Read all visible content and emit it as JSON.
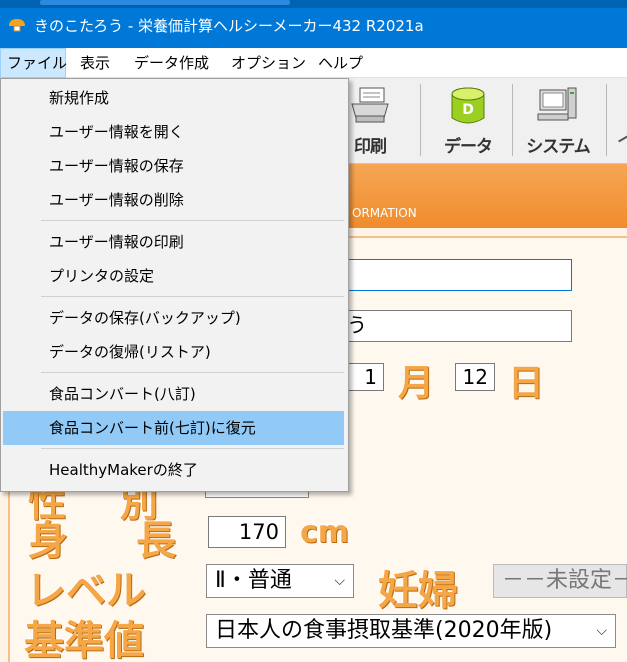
{
  "window": {
    "title": "きのこたろう - 栄養価計算ヘルシーメーカー432 R2021a"
  },
  "menubar": {
    "items": [
      "ファイル",
      "表示",
      "データ作成",
      "オプション",
      "ヘルプ"
    ]
  },
  "toolbar": {
    "buttons": [
      {
        "label": "印刷",
        "icon": "printer-icon"
      },
      {
        "label": "データ",
        "icon": "database-icon"
      },
      {
        "label": "システム",
        "icon": "computer-icon"
      }
    ]
  },
  "header": {
    "subtitle": "ORMATION"
  },
  "file_menu": {
    "items": [
      "新規作成",
      "ユーザー情報を開く",
      "ユーザー情報の保存",
      "ユーザー情報の削除",
      "ユーザー情報の印刷",
      "プリンタの設定",
      "データの保存(バックアップ)",
      "データの復帰(リストア)",
      "食品コンバート(八訂)",
      "食品コンバート前(七訂)に復元",
      "HealthyMakerの終了"
    ],
    "highlighted_index": 9
  },
  "form": {
    "field2_value": "う",
    "birth_month": "1",
    "birth_day": "12",
    "month_label": "月",
    "day_label": "日",
    "sex_label": "性　別",
    "height_label": "身　長",
    "height_value": "170",
    "height_unit": "cm",
    "level_label": "レベル",
    "level_value": "Ⅱ・普通",
    "pregnant_label": "妊婦",
    "pregnant_value": "－－未設定－－",
    "standard_label": "基準値",
    "standard_value": "日本人の食事摂取基準(2020年版)"
  },
  "colors": {
    "titlebar": "#0078d7",
    "accent_orange": "#f08c2c",
    "menu_highlight": "#91c9f7"
  }
}
